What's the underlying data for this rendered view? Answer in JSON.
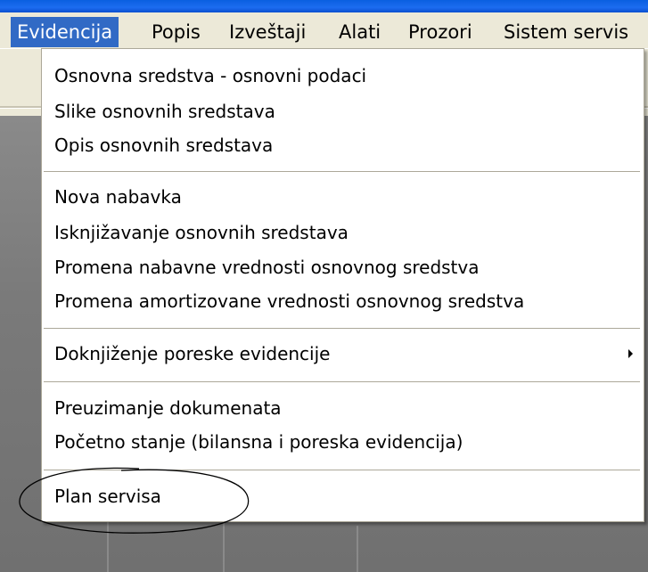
{
  "menubar": {
    "items": [
      {
        "label": "Evidencija"
      },
      {
        "label": "Popis"
      },
      {
        "label": "Izveštaji"
      },
      {
        "label": "Alati"
      },
      {
        "label": "Prozori"
      },
      {
        "label": "Sistem servis"
      }
    ]
  },
  "menu": {
    "group1": [
      {
        "label": "Osnovna sredstva - osnovni podaci"
      },
      {
        "label": "Slike osnovnih sredstava"
      },
      {
        "label": "Opis osnovnih sredstava"
      }
    ],
    "group2": [
      {
        "label": "Nova nabavka"
      },
      {
        "label": "Isknjižavanje osnovnih sredstava"
      },
      {
        "label": "Promena nabavne vrednosti osnovnog sredstva"
      },
      {
        "label": "Promena amortizovane vrednosti osnovnog sredstva"
      }
    ],
    "group3": [
      {
        "label": "Doknjiženje poreske evidencije"
      }
    ],
    "group4": [
      {
        "label": "Preuzimanje dokumenata"
      },
      {
        "label": "Početno stanje (bilansna i poreska evidencija)"
      }
    ],
    "group5": [
      {
        "label": "Plan servisa"
      }
    ]
  },
  "colors": {
    "menu_highlight": "#316ac5",
    "menu_background": "#ece9d8",
    "title_bar": "#1c6cf0",
    "annotation_ellipse": "#000000"
  }
}
